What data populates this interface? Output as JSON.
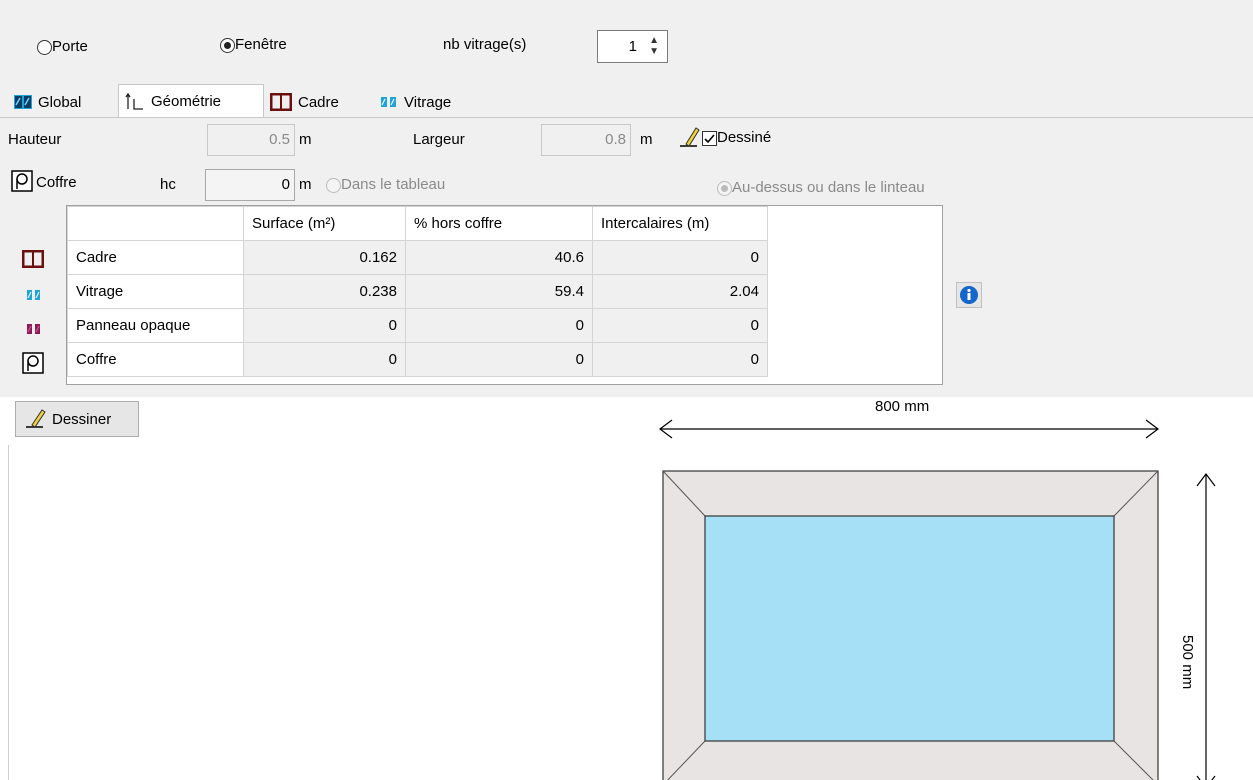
{
  "radio": {
    "porte_label": "Porte",
    "fenetre_label": "Fenêtre",
    "selected": "Fenêtre",
    "nb_vitrage_label": "nb vitrage(s)",
    "nb_vitrage_value": "1"
  },
  "tabs": [
    {
      "label": "Global",
      "icon": "window-glass-icon"
    },
    {
      "label": "Géométrie",
      "icon": "dimension-icon",
      "active": true
    },
    {
      "label": "Cadre",
      "icon": "frame-icon"
    },
    {
      "label": "Vitrage",
      "icon": "glazing-icon"
    }
  ],
  "geometry": {
    "hauteur_label": "Hauteur",
    "hauteur_value": "0.5",
    "hauteur_unit": "m",
    "largeur_label": "Largeur",
    "largeur_value": "0.8",
    "largeur_unit": "m",
    "dessine_label": "Dessiné",
    "dessine_checked": true,
    "coffre_label": "Coffre",
    "hc_label": "hc",
    "hc_value": "0",
    "hc_unit": "m",
    "dans_tableau_label": "Dans le tableau",
    "au_dessus_label": "Au-dessus ou dans le linteau"
  },
  "table": {
    "headers": [
      "",
      "Surface (m²)",
      "% hors coffre",
      "Intercalaires (m)"
    ],
    "rows": [
      {
        "icon": "frame-icon",
        "label": "Cadre",
        "surface": "0.162",
        "pct": "40.6",
        "intercalaires": "0"
      },
      {
        "icon": "glazing-icon",
        "label": "Vitrage",
        "surface": "0.238",
        "pct": "59.4",
        "intercalaires": "2.04"
      },
      {
        "icon": "opaque-panel-icon",
        "label": "Panneau opaque",
        "surface": "0",
        "pct": "0",
        "intercalaires": "0"
      },
      {
        "icon": "coffre-icon",
        "label": "Coffre",
        "surface": "0",
        "pct": "0",
        "intercalaires": "0"
      }
    ]
  },
  "drawing": {
    "button_label": "Dessiner",
    "width_label": "800 mm",
    "height_label": "500 mm"
  },
  "colors": {
    "glass": "#a6e0f7",
    "frame": "#e8e4e3",
    "frame_icon": "#6b0f0f",
    "glazing_icon": "#1fa3d8",
    "opaque_icon": "#8b1a55",
    "info_icon": "#1466c9"
  }
}
